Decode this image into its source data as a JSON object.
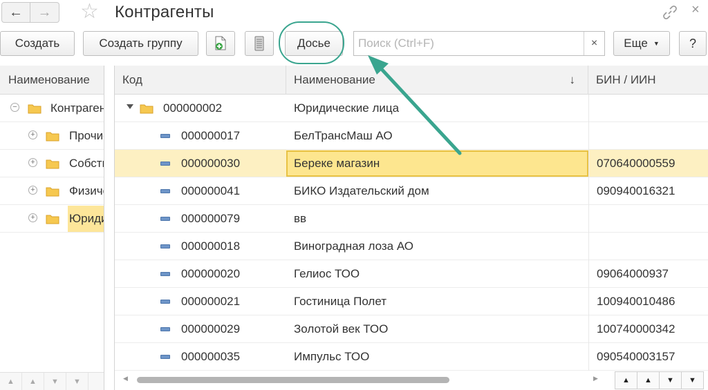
{
  "window": {
    "title": "Контрагенты"
  },
  "nav": {
    "back_icon": "arrow-left-icon",
    "forward_icon": "arrow-right-icon",
    "favorite_icon": "star-icon",
    "link_icon": "link-icon",
    "close_icon": "close-icon"
  },
  "toolbar": {
    "create_label": "Создать",
    "create_group_label": "Создать группу",
    "add_icon": "add-document-icon",
    "list_icon": "list-icon",
    "dossier_label": "Досье",
    "search_placeholder": "Поиск (Ctrl+F)",
    "search_value": "",
    "clear_label": "×",
    "more_label": "Еще",
    "help_label": "?"
  },
  "tree": {
    "header": "Наименование",
    "items": [
      {
        "label": "Контрагенты",
        "expander": "−",
        "selected": false
      },
      {
        "label": "Прочие",
        "expander": "+",
        "selected": false
      },
      {
        "label": "Собственные",
        "expander": "+",
        "selected": false
      },
      {
        "label": "Физические лица",
        "expander": "+",
        "selected": false
      },
      {
        "label": "Юридические лица",
        "expander": "+",
        "selected": true
      }
    ]
  },
  "table": {
    "columns": [
      "Код",
      "Наименование",
      "БИН / ИИН"
    ],
    "sort_indicator": "↓",
    "rows": [
      {
        "code": "000000002",
        "name": "Юридические лица",
        "bin": "",
        "type": "group"
      },
      {
        "code": "000000017",
        "name": "БелТрансМаш АО",
        "bin": "",
        "type": "item"
      },
      {
        "code": "000000030",
        "name": "Береке магазин",
        "bin": "070640000559",
        "type": "item",
        "selected": true
      },
      {
        "code": "000000041",
        "name": "БИКО Издательский дом",
        "bin": "090940016321",
        "type": "item"
      },
      {
        "code": "000000079",
        "name": "вв",
        "bin": "",
        "type": "item"
      },
      {
        "code": "000000018",
        "name": "Виноградная лоза АО",
        "bin": "",
        "type": "item"
      },
      {
        "code": "000000020",
        "name": "Гелиос ТОО",
        "bin": "09064000937",
        "type": "item"
      },
      {
        "code": "000000021",
        "name": "Гостиница Полет",
        "bin": "100940010486",
        "type": "item"
      },
      {
        "code": "000000029",
        "name": "Золотой век ТОО",
        "bin": "100740000342",
        "type": "item"
      },
      {
        "code": "000000035",
        "name": "Импульс ТОО",
        "bin": "090540003157",
        "type": "item"
      }
    ]
  },
  "colors": {
    "selection_fill": "#fde68f",
    "selection_border": "#e8c244",
    "row_highlight": "#fdf0c2",
    "annotation": "#3aa58f"
  }
}
